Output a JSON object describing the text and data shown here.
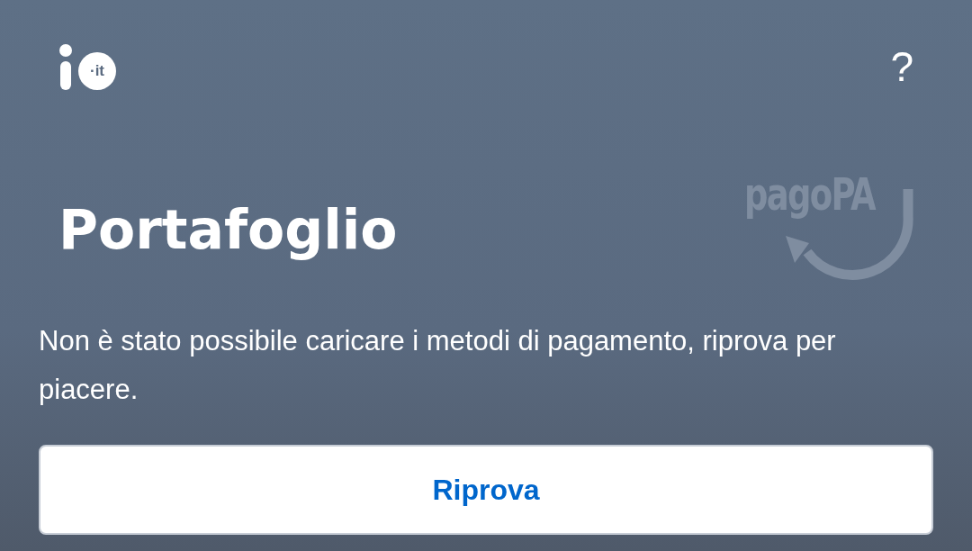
{
  "header": {
    "logo_badge": "·it",
    "help": "?"
  },
  "title": "Portafoglio",
  "brand_mark": {
    "text": "pagoPA"
  },
  "message": "Non è stato possibile caricare i metodi di pagamento, riprova per piacere.",
  "buttons": [
    {
      "label": "Riprova",
      "kind": "outline"
    }
  ]
}
